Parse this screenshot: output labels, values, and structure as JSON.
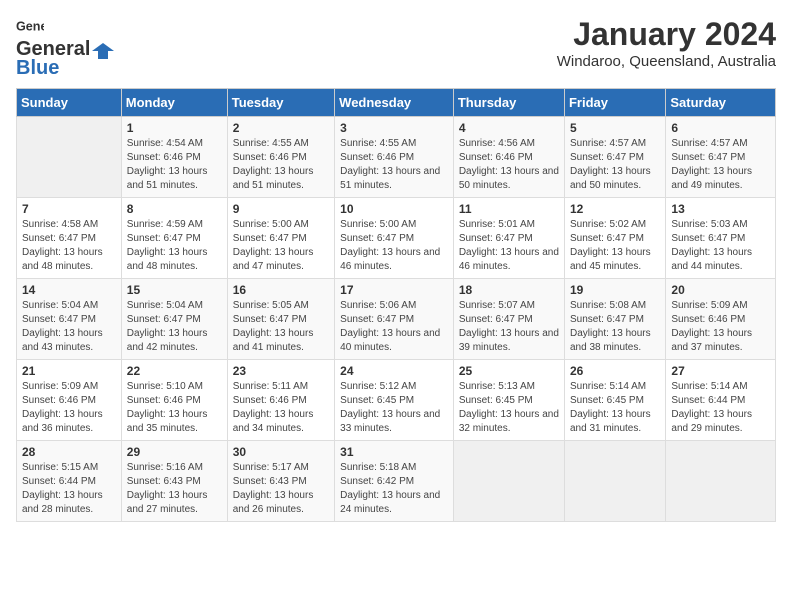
{
  "logo": {
    "general": "General",
    "blue": "Blue"
  },
  "title": "January 2024",
  "subtitle": "Windaroo, Queensland, Australia",
  "days_of_week": [
    "Sunday",
    "Monday",
    "Tuesday",
    "Wednesday",
    "Thursday",
    "Friday",
    "Saturday"
  ],
  "weeks": [
    [
      {
        "day": "",
        "sunrise": "",
        "sunset": "",
        "daylight": ""
      },
      {
        "day": "1",
        "sunrise": "Sunrise: 4:54 AM",
        "sunset": "Sunset: 6:46 PM",
        "daylight": "Daylight: 13 hours and 51 minutes."
      },
      {
        "day": "2",
        "sunrise": "Sunrise: 4:55 AM",
        "sunset": "Sunset: 6:46 PM",
        "daylight": "Daylight: 13 hours and 51 minutes."
      },
      {
        "day": "3",
        "sunrise": "Sunrise: 4:55 AM",
        "sunset": "Sunset: 6:46 PM",
        "daylight": "Daylight: 13 hours and 51 minutes."
      },
      {
        "day": "4",
        "sunrise": "Sunrise: 4:56 AM",
        "sunset": "Sunset: 6:46 PM",
        "daylight": "Daylight: 13 hours and 50 minutes."
      },
      {
        "day": "5",
        "sunrise": "Sunrise: 4:57 AM",
        "sunset": "Sunset: 6:47 PM",
        "daylight": "Daylight: 13 hours and 50 minutes."
      },
      {
        "day": "6",
        "sunrise": "Sunrise: 4:57 AM",
        "sunset": "Sunset: 6:47 PM",
        "daylight": "Daylight: 13 hours and 49 minutes."
      }
    ],
    [
      {
        "day": "7",
        "sunrise": "Sunrise: 4:58 AM",
        "sunset": "Sunset: 6:47 PM",
        "daylight": "Daylight: 13 hours and 48 minutes."
      },
      {
        "day": "8",
        "sunrise": "Sunrise: 4:59 AM",
        "sunset": "Sunset: 6:47 PM",
        "daylight": "Daylight: 13 hours and 48 minutes."
      },
      {
        "day": "9",
        "sunrise": "Sunrise: 5:00 AM",
        "sunset": "Sunset: 6:47 PM",
        "daylight": "Daylight: 13 hours and 47 minutes."
      },
      {
        "day": "10",
        "sunrise": "Sunrise: 5:00 AM",
        "sunset": "Sunset: 6:47 PM",
        "daylight": "Daylight: 13 hours and 46 minutes."
      },
      {
        "day": "11",
        "sunrise": "Sunrise: 5:01 AM",
        "sunset": "Sunset: 6:47 PM",
        "daylight": "Daylight: 13 hours and 46 minutes."
      },
      {
        "day": "12",
        "sunrise": "Sunrise: 5:02 AM",
        "sunset": "Sunset: 6:47 PM",
        "daylight": "Daylight: 13 hours and 45 minutes."
      },
      {
        "day": "13",
        "sunrise": "Sunrise: 5:03 AM",
        "sunset": "Sunset: 6:47 PM",
        "daylight": "Daylight: 13 hours and 44 minutes."
      }
    ],
    [
      {
        "day": "14",
        "sunrise": "Sunrise: 5:04 AM",
        "sunset": "Sunset: 6:47 PM",
        "daylight": "Daylight: 13 hours and 43 minutes."
      },
      {
        "day": "15",
        "sunrise": "Sunrise: 5:04 AM",
        "sunset": "Sunset: 6:47 PM",
        "daylight": "Daylight: 13 hours and 42 minutes."
      },
      {
        "day": "16",
        "sunrise": "Sunrise: 5:05 AM",
        "sunset": "Sunset: 6:47 PM",
        "daylight": "Daylight: 13 hours and 41 minutes."
      },
      {
        "day": "17",
        "sunrise": "Sunrise: 5:06 AM",
        "sunset": "Sunset: 6:47 PM",
        "daylight": "Daylight: 13 hours and 40 minutes."
      },
      {
        "day": "18",
        "sunrise": "Sunrise: 5:07 AM",
        "sunset": "Sunset: 6:47 PM",
        "daylight": "Daylight: 13 hours and 39 minutes."
      },
      {
        "day": "19",
        "sunrise": "Sunrise: 5:08 AM",
        "sunset": "Sunset: 6:47 PM",
        "daylight": "Daylight: 13 hours and 38 minutes."
      },
      {
        "day": "20",
        "sunrise": "Sunrise: 5:09 AM",
        "sunset": "Sunset: 6:46 PM",
        "daylight": "Daylight: 13 hours and 37 minutes."
      }
    ],
    [
      {
        "day": "21",
        "sunrise": "Sunrise: 5:09 AM",
        "sunset": "Sunset: 6:46 PM",
        "daylight": "Daylight: 13 hours and 36 minutes."
      },
      {
        "day": "22",
        "sunrise": "Sunrise: 5:10 AM",
        "sunset": "Sunset: 6:46 PM",
        "daylight": "Daylight: 13 hours and 35 minutes."
      },
      {
        "day": "23",
        "sunrise": "Sunrise: 5:11 AM",
        "sunset": "Sunset: 6:46 PM",
        "daylight": "Daylight: 13 hours and 34 minutes."
      },
      {
        "day": "24",
        "sunrise": "Sunrise: 5:12 AM",
        "sunset": "Sunset: 6:45 PM",
        "daylight": "Daylight: 13 hours and 33 minutes."
      },
      {
        "day": "25",
        "sunrise": "Sunrise: 5:13 AM",
        "sunset": "Sunset: 6:45 PM",
        "daylight": "Daylight: 13 hours and 32 minutes."
      },
      {
        "day": "26",
        "sunrise": "Sunrise: 5:14 AM",
        "sunset": "Sunset: 6:45 PM",
        "daylight": "Daylight: 13 hours and 31 minutes."
      },
      {
        "day": "27",
        "sunrise": "Sunrise: 5:14 AM",
        "sunset": "Sunset: 6:44 PM",
        "daylight": "Daylight: 13 hours and 29 minutes."
      }
    ],
    [
      {
        "day": "28",
        "sunrise": "Sunrise: 5:15 AM",
        "sunset": "Sunset: 6:44 PM",
        "daylight": "Daylight: 13 hours and 28 minutes."
      },
      {
        "day": "29",
        "sunrise": "Sunrise: 5:16 AM",
        "sunset": "Sunset: 6:43 PM",
        "daylight": "Daylight: 13 hours and 27 minutes."
      },
      {
        "day": "30",
        "sunrise": "Sunrise: 5:17 AM",
        "sunset": "Sunset: 6:43 PM",
        "daylight": "Daylight: 13 hours and 26 minutes."
      },
      {
        "day": "31",
        "sunrise": "Sunrise: 5:18 AM",
        "sunset": "Sunset: 6:42 PM",
        "daylight": "Daylight: 13 hours and 24 minutes."
      },
      {
        "day": "",
        "sunrise": "",
        "sunset": "",
        "daylight": ""
      },
      {
        "day": "",
        "sunrise": "",
        "sunset": "",
        "daylight": ""
      },
      {
        "day": "",
        "sunrise": "",
        "sunset": "",
        "daylight": ""
      }
    ]
  ]
}
